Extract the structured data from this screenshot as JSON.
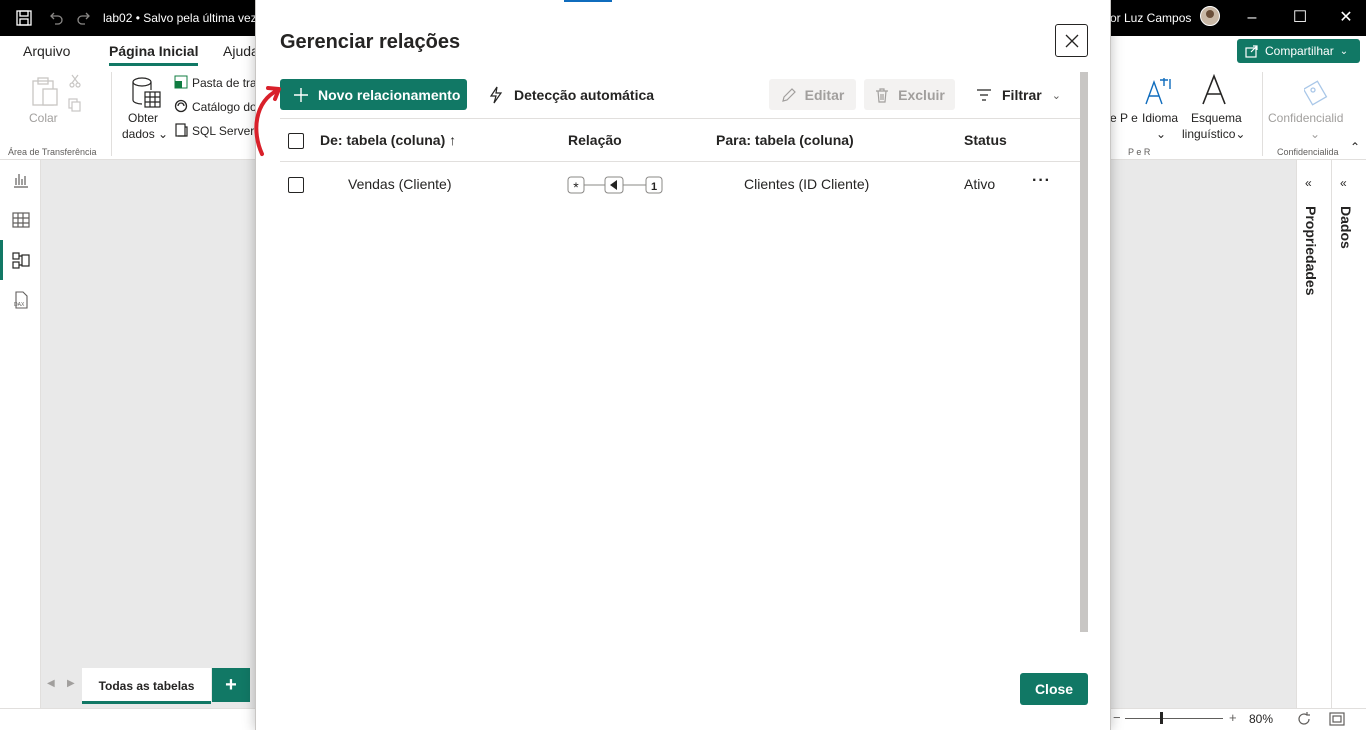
{
  "titlebar": {
    "doc_title": "lab02 • Salvo pela última vez",
    "user": "or Luz Campos"
  },
  "ribbon_tabs": {
    "arquivo": "Arquivo",
    "pagina_inicial": "Página Inicial",
    "ajuda": "Ajuda",
    "share": "Compartilhar"
  },
  "ribbon": {
    "colar": "Colar",
    "area_transferencia": "Área de Transferência",
    "obter": "Obter",
    "dados": "dados",
    "pasta": "Pasta de tra",
    "catalogo": "Catálogo do",
    "sql": "SQL Server",
    "pe_r_partial": "e P e",
    "idioma": "Idioma",
    "esquema": "Esquema",
    "linguistico": "linguístico",
    "p_e_r": "P e R",
    "confidencialidade_btn": "Confidencialid",
    "confidencialidade_group": "Confidencialida"
  },
  "panes": {
    "propriedades": "Propriedades",
    "dados": "Dados"
  },
  "bottom": {
    "page_tab": "Todas as tabelas",
    "add": "+",
    "zoom": "80%"
  },
  "dialog": {
    "title": "Gerenciar relações",
    "new_relationship": "Novo relacionamento",
    "auto_detect": "Detecção automática",
    "edit": "Editar",
    "delete": "Excluir",
    "filter": "Filtrar",
    "columns": {
      "from": "De: tabela (coluna)",
      "relation": "Relação",
      "to": "Para: tabela (coluna)",
      "status": "Status"
    },
    "rows": [
      {
        "from": "Vendas (Cliente)",
        "cardinality_from": "*",
        "cardinality_to": "1",
        "to": "Clientes (ID Cliente)",
        "status": "Ativo",
        "more": "···"
      }
    ],
    "close": "Close"
  },
  "colors": {
    "accent": "#117865",
    "annotation": "#d9202a"
  }
}
